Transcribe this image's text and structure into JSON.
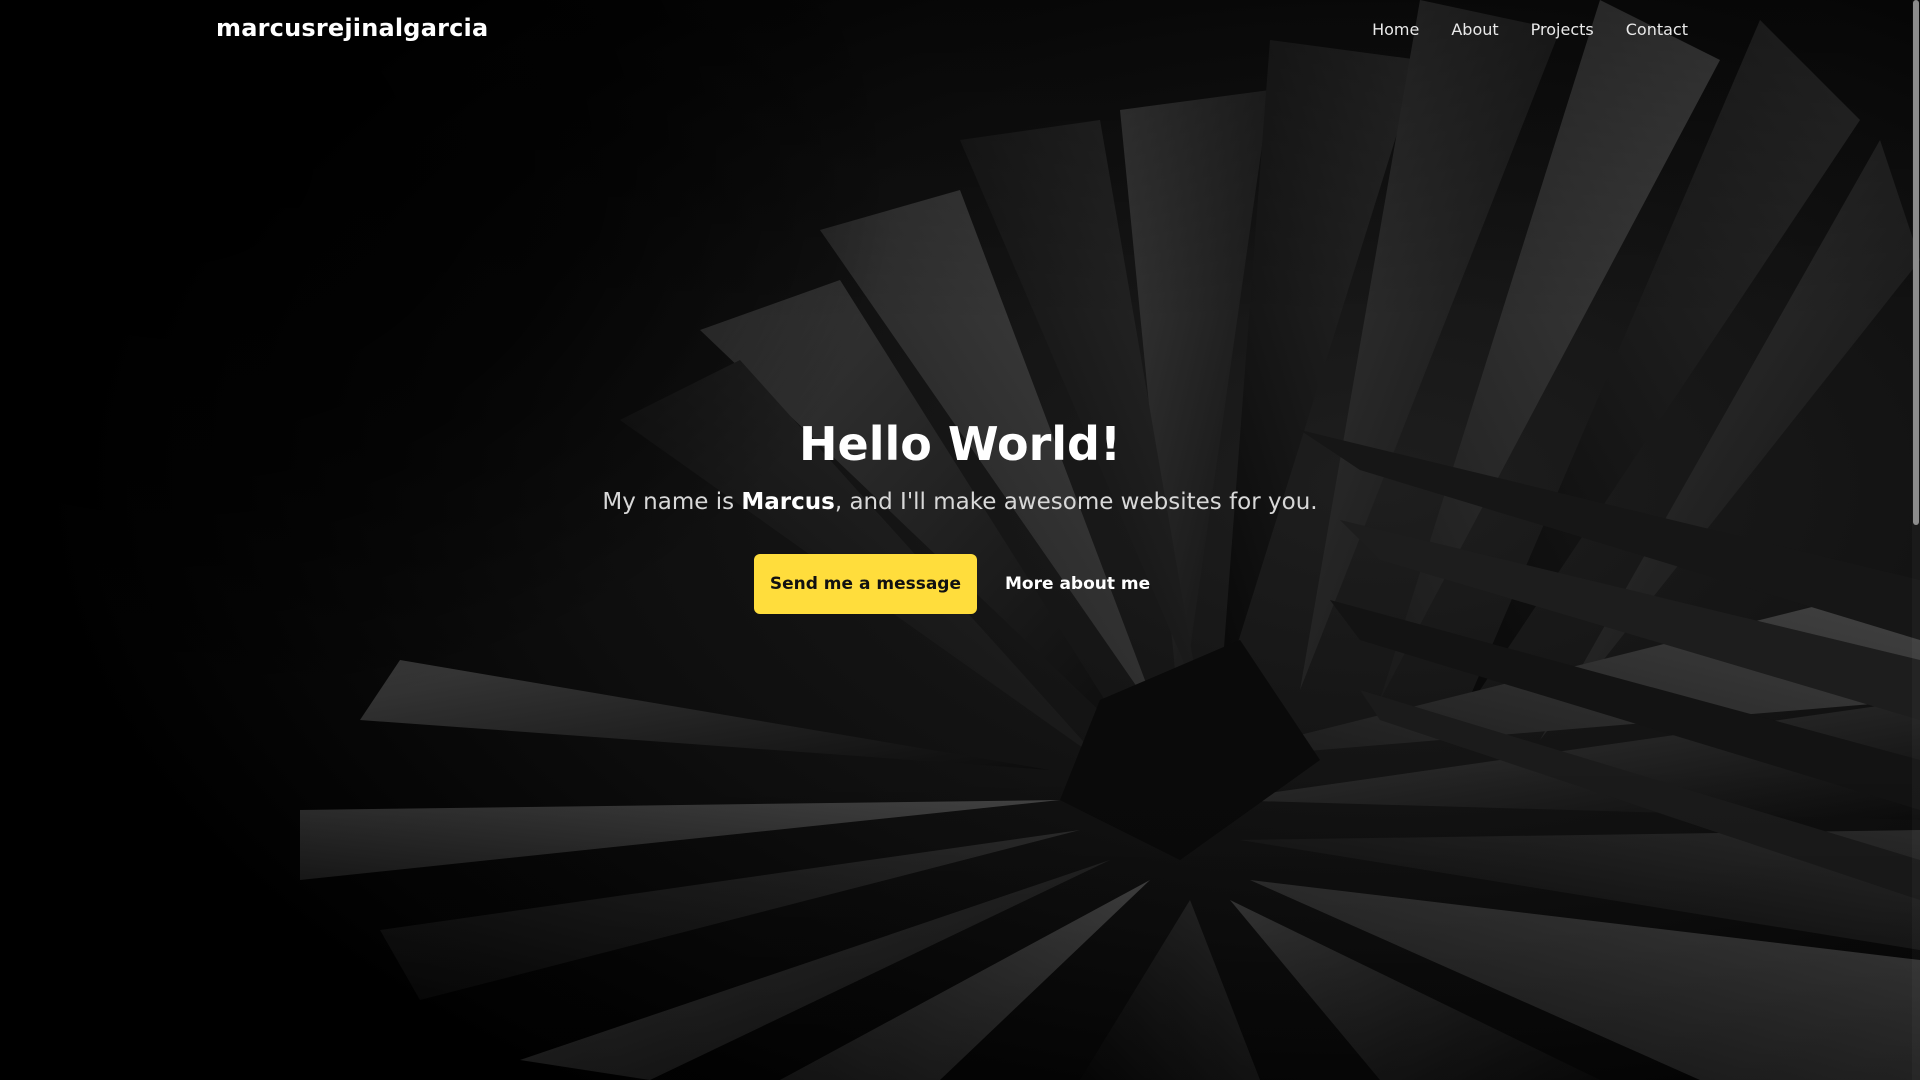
{
  "navbar": {
    "brand": "marcusrejinalgarcia",
    "links": [
      {
        "label": "Home"
      },
      {
        "label": "About"
      },
      {
        "label": "Projects"
      },
      {
        "label": "Contact"
      }
    ]
  },
  "hero": {
    "title": "Hello World!",
    "subtitle_prefix": "My name is ",
    "subtitle_name": "Marcus",
    "subtitle_suffix": ", and I'll make awesome websites for you.",
    "primary_button": "Send me a message",
    "secondary_button": "More about me"
  },
  "colors": {
    "background": "#000000",
    "accent": "#ffdd3c",
    "text": "#ffffff"
  },
  "background_image": {
    "icon": "abstract-folded-paper-image"
  },
  "scroll": {
    "position_fraction": 0.0,
    "visible_fraction": 0.49
  }
}
